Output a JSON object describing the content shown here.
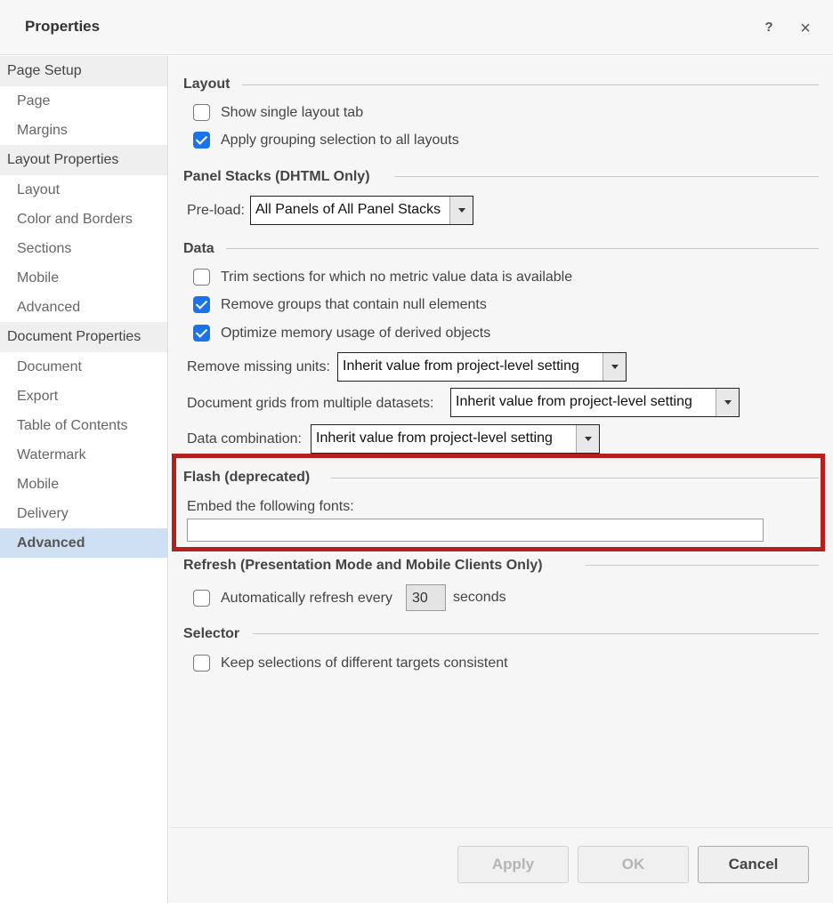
{
  "window": {
    "title": "Properties",
    "help_label": "?",
    "close_label": "×"
  },
  "sidebar": {
    "groups": [
      {
        "label": "Page Setup",
        "items": [
          "Page",
          "Margins"
        ]
      },
      {
        "label": "Layout Properties",
        "items": [
          "Layout",
          "Color and Borders",
          "Sections",
          "Mobile",
          "Advanced"
        ]
      },
      {
        "label": "Document Properties",
        "items": [
          "Document",
          "Export",
          "Table of Contents",
          "Watermark",
          "Mobile",
          "Delivery",
          "Advanced"
        ]
      }
    ],
    "active_item": "Document Properties > Advanced"
  },
  "layout_section": {
    "title": "Layout",
    "show_single_tab": {
      "label": "Show single layout tab",
      "checked": false
    },
    "apply_grouping": {
      "label": "Apply grouping selection to all layouts",
      "checked": true
    }
  },
  "panel_stacks": {
    "title": "Panel Stacks (DHTML Only)",
    "preload_label": "Pre-load:",
    "preload_value": "All Panels of All Panel Stacks"
  },
  "data_section": {
    "title": "Data",
    "trim_sections": {
      "label": "Trim sections for which no metric value data is available",
      "checked": false
    },
    "remove_groups": {
      "label": "Remove groups that contain null elements",
      "checked": true
    },
    "optimize_memory": {
      "label": "Optimize memory usage of derived objects",
      "checked": true
    },
    "remove_missing_units": {
      "label": "Remove missing units:",
      "value": "Inherit value from project-level setting"
    },
    "doc_grids": {
      "label": "Document grids from multiple datasets:",
      "value": "Inherit value from project-level setting"
    },
    "data_combination": {
      "label": "Data combination:",
      "value": "Inherit value from project-level setting"
    }
  },
  "flash": {
    "title": "Flash (deprecated)",
    "embed_label": "Embed the following fonts:",
    "embed_value": "",
    "highlight_color": "#b3201d"
  },
  "refresh": {
    "title": "Refresh (Presentation Mode and Mobile Clients Only)",
    "auto_refresh": {
      "label": "Automatically refresh every",
      "checked": false
    },
    "interval": "30",
    "unit": "seconds"
  },
  "selector": {
    "title": "Selector",
    "keep_consistent": {
      "label": "Keep selections of different targets consistent",
      "checked": false
    }
  },
  "buttons": {
    "apply": "Apply",
    "ok": "OK",
    "cancel": "Cancel"
  }
}
